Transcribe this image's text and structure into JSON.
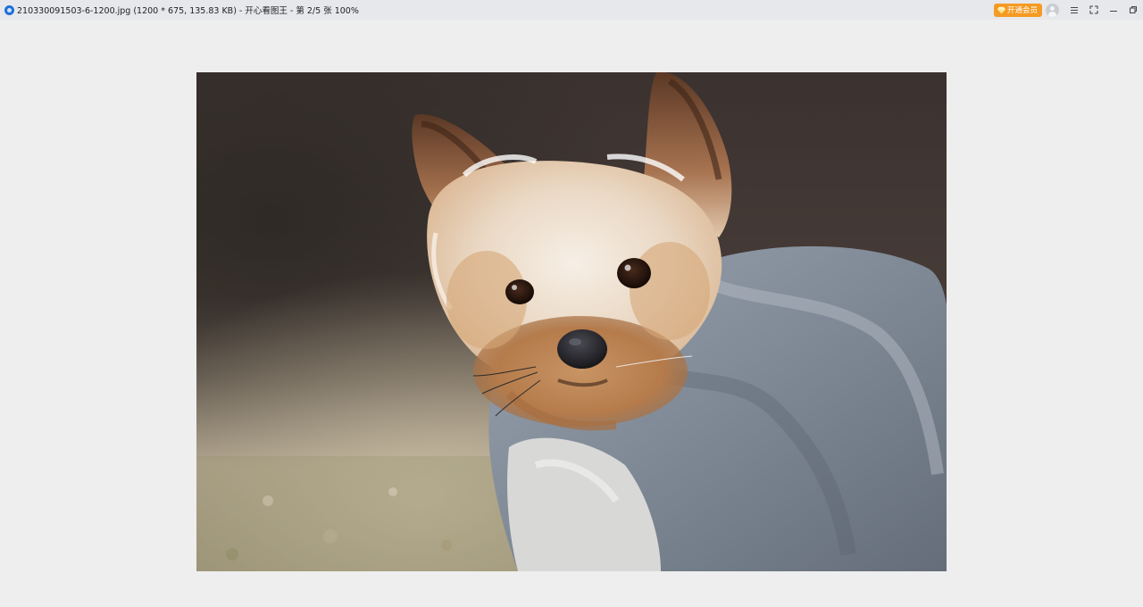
{
  "window": {
    "title": "210330091503-6-1200.jpg (1200 * 675, 135.83 KB) - 开心看图王 - 第 2/5 张 100%"
  },
  "titlebar": {
    "vip_label": "开通会员",
    "vip_color": "#f59a23",
    "icons": {
      "app": "app-logo-icon",
      "vip": "diamond-icon",
      "avatar": "user-avatar-icon",
      "menu": "menu-icon",
      "fullscreen": "fullscreen-icon",
      "minimize": "minimize-icon",
      "restore": "restore-icon"
    }
  },
  "viewer": {
    "background": "#eeeeee",
    "image_subject": "dog-photo"
  }
}
